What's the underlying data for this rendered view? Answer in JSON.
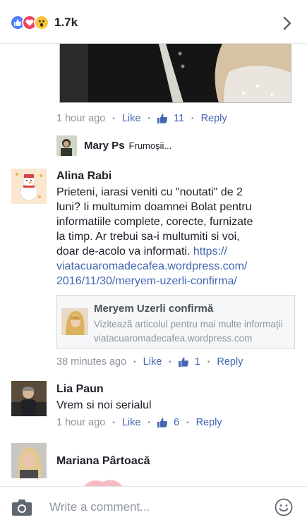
{
  "header": {
    "reaction_count": "1.7k",
    "reactions": [
      "like-icon",
      "love-icon",
      "wow-icon"
    ]
  },
  "labels": {
    "like": "Like",
    "reply": "Reply",
    "dot": "•"
  },
  "post": {
    "time": "1 hour ago",
    "like_count": "11"
  },
  "reply_preview": {
    "name": "Mary Ps",
    "text": "Frumoşii..."
  },
  "comments": [
    {
      "name": "Alina Rabi",
      "lines": [
        "Prieteni, iarasi veniti cu \"noutati\" de 2",
        "luni? Ii multumim doamnei Bolat pentru",
        "informatiile complete, corecte, furnizate",
        "la timp. Ar trebui sa-i multumiti si voi,",
        "doar de-acolo va informati."
      ],
      "link_start": "https://",
      "link_lines": [
        "viatacuaromadecafea.wordpress.com/",
        "2016/11/30/meryem-uzerli-confirma/"
      ],
      "link_card": {
        "title": "Meryem Uzerli confirmă",
        "description": "Vizitează articolul pentru mai multe informații",
        "domain": "viatacuaromadecafea.wordpress.com"
      },
      "time": "38 minutes ago",
      "like_count": "1"
    },
    {
      "name": "Lia Paun",
      "text": "Vrem si noi serialul",
      "time": "1 hour ago",
      "like_count": "6"
    },
    {
      "name": "Mariana Pârtoacă"
    }
  ],
  "composer": {
    "placeholder": "Write a comment..."
  },
  "colors": {
    "link": "#4267b2",
    "meta": "#8d949e",
    "like_reaction": "#4f7dff",
    "love_reaction": "#f2415c",
    "wow_reaction": "#f8c43a"
  }
}
